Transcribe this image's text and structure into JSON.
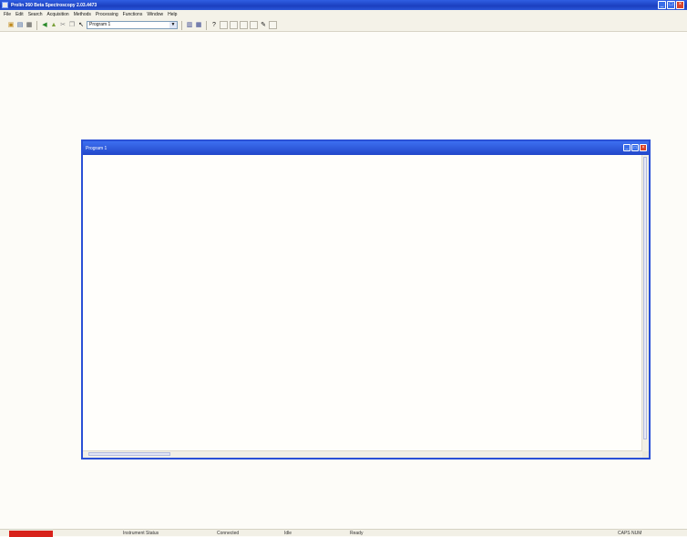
{
  "app": {
    "title": "Prolin 360 Beta Spectroscopy 2.03.4473",
    "controls": {
      "minimize": "_",
      "maximize": "□",
      "close": "×"
    }
  },
  "menu": [
    "File",
    "Edit",
    "Search",
    "Acquisition",
    "Methods",
    "Processing",
    "Functions",
    "Window",
    "Help"
  ],
  "toolbar": {
    "icons": [
      "open-icon",
      "save-icon",
      "print-icon",
      "arrow-icon",
      "new-icon",
      "cut-icon",
      "copy-icon",
      "cursor-icon"
    ],
    "combo_value": "Program 1",
    "icons_after": [
      "chart-icon",
      "grid-icon",
      "info-icon",
      "blank-1",
      "blank-2",
      "blank-3",
      "blank-4",
      "zoom-icon",
      "blank-5"
    ]
  },
  "child": {
    "title": "Program 1",
    "controls": {
      "minimize": "_",
      "maximize": "□",
      "close": "×"
    }
  },
  "status": {
    "field1": "Instrument Status",
    "field2": "Connected",
    "field3": "Idle",
    "field4": "Ready",
    "right": "CAPS NUM"
  }
}
